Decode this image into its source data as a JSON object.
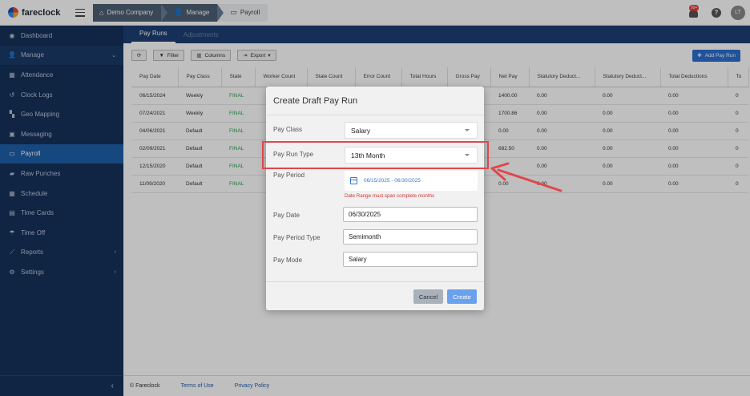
{
  "brand": {
    "name": "fareclock"
  },
  "breadcrumb": [
    {
      "label": "Demo Company"
    },
    {
      "label": "Manage"
    },
    {
      "label": "Payroll"
    }
  ],
  "header": {
    "notification_count": "99+",
    "help": "?",
    "avatar_initials": "LT"
  },
  "sidebar": {
    "items": [
      {
        "label": "Dashboard",
        "icon": "gauge-icon",
        "glyph": "◉"
      },
      {
        "label": "Manage",
        "icon": "user-icon",
        "glyph": "👤",
        "chevron": "⌄"
      },
      {
        "label": "Attendance",
        "icon": "attendance-icon",
        "glyph": "▦"
      },
      {
        "label": "Clock Logs",
        "icon": "history-icon",
        "glyph": "↺"
      },
      {
        "label": "Geo Mapping",
        "icon": "map-icon",
        "glyph": "▚"
      },
      {
        "label": "Messaging",
        "icon": "chat-icon",
        "glyph": "▣"
      },
      {
        "label": "Payroll",
        "icon": "money-icon",
        "glyph": "▭"
      },
      {
        "label": "Raw Punches",
        "icon": "truck-icon",
        "glyph": "▰"
      },
      {
        "label": "Schedule",
        "icon": "calendar-icon",
        "glyph": "▦"
      },
      {
        "label": "Time Cards",
        "icon": "card-icon",
        "glyph": "▤"
      },
      {
        "label": "Time Off",
        "icon": "beach-icon",
        "glyph": "☂"
      },
      {
        "label": "Reports",
        "icon": "chart-icon",
        "glyph": "⟋",
        "chevron": "‹"
      },
      {
        "label": "Settings",
        "icon": "gear-icon",
        "glyph": "⚙",
        "chevron": "‹"
      }
    ],
    "collapse_glyph": "‹"
  },
  "subtabs": [
    {
      "label": "Pay Runs"
    },
    {
      "label": "Adjustments"
    }
  ],
  "toolbar": {
    "refresh": "⟳",
    "filter": "Filter",
    "columns": "Columns",
    "export": "Export",
    "add": "Add Pay Run"
  },
  "table": {
    "columns": [
      "Pay Date",
      "Pay Class",
      "State",
      "Worker Count",
      "Stale Count",
      "Error Count",
      "Total Hours",
      "Gross Pay",
      "Net Pay",
      "Statutory Deduct...",
      "Statutory Deduct...",
      "Total Deductions",
      "To"
    ],
    "rows": [
      [
        "06/15/2024",
        "Weekly",
        "FINAL",
        "",
        "",
        "",
        "",
        "",
        "1400.00",
        "0.00",
        "0.00",
        "0.00",
        "0"
      ],
      [
        "07/24/2021",
        "Weekly",
        "FINAL",
        "",
        "",
        "",
        "",
        "",
        "1700.86",
        "0.00",
        "0.00",
        "0.00",
        "0"
      ],
      [
        "04/06/2021",
        "Default",
        "FINAL",
        "",
        "",
        "",
        "",
        "",
        "0.00",
        "0.00",
        "0.00",
        "0.00",
        "0"
      ],
      [
        "02/09/2021",
        "Default",
        "FINAL",
        "",
        "",
        "",
        "",
        "",
        "682.50",
        "0.00",
        "0.00",
        "0.00",
        "0"
      ],
      [
        "12/15/2020",
        "Default",
        "FINAL",
        "",
        "",
        "",
        "",
        "",
        "",
        "0.00",
        "0.00",
        "0.00",
        "0"
      ],
      [
        "11/09/2020",
        "Default",
        "FINAL",
        "",
        "",
        "",
        "",
        "",
        "0.00",
        "0.00",
        "0.00",
        "0.00",
        "0"
      ]
    ]
  },
  "footer": {
    "copyright": "© Fareclock",
    "terms": "Terms of Use",
    "privacy": "Privacy Policy"
  },
  "modal": {
    "title": "Create Draft Pay Run",
    "pay_class": {
      "label": "Pay Class",
      "value": "Salary"
    },
    "pay_run_type": {
      "label": "Pay Run Type",
      "value": "13th Month"
    },
    "pay_period": {
      "label": "Pay Period",
      "value": "06/15/2025 - 06/30/2025",
      "error": "Date Range must span complete months"
    },
    "pay_date": {
      "label": "Pay Date",
      "value": "06/30/2025"
    },
    "pay_period_type": {
      "label": "Pay Period Type",
      "value": "Semimonth"
    },
    "pay_mode": {
      "label": "Pay Mode",
      "value": "Salary"
    },
    "cancel": "Cancel",
    "create": "Create"
  },
  "colors": {
    "sidebar": "#16305a",
    "active": "#1e5fa8",
    "final": "#2aa44f",
    "annotation": "#e0474c",
    "primary": "#2d6fd0"
  }
}
